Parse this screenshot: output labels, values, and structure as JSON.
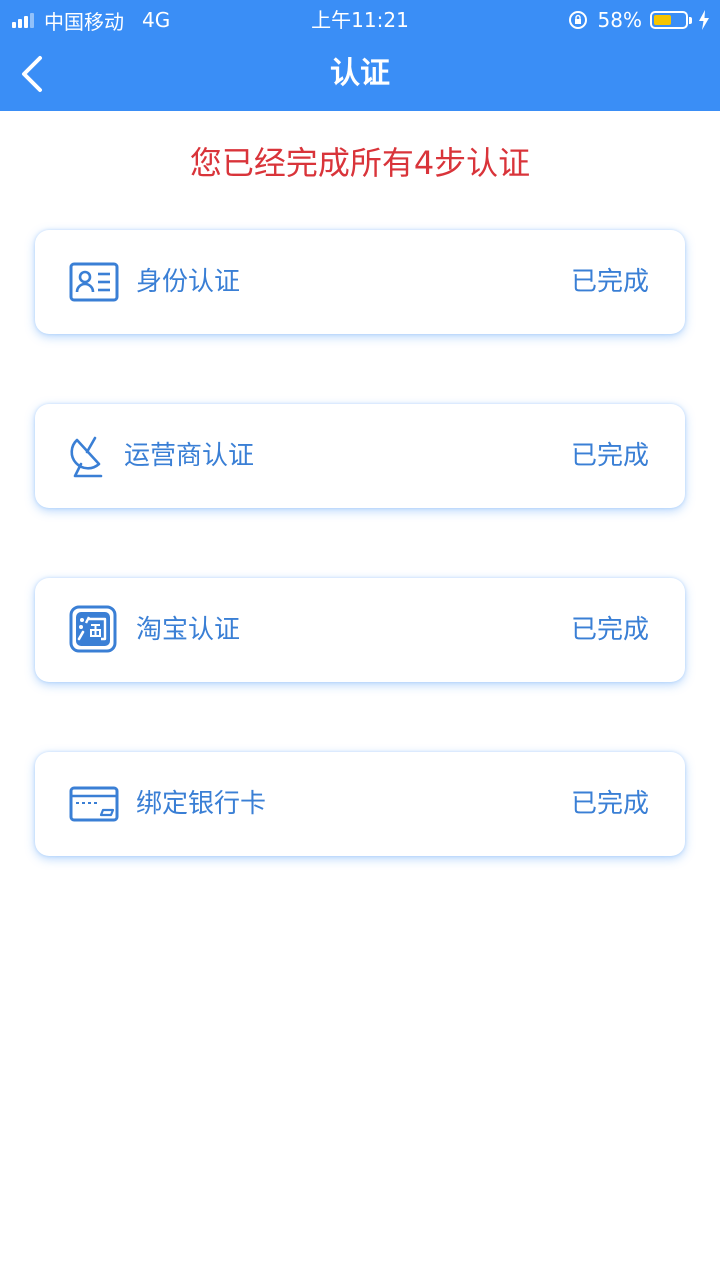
{
  "status_bar": {
    "carrier": "中国移动",
    "network": "4G",
    "time": "上午11:21",
    "battery_percent": "58%",
    "battery_level": 0.58
  },
  "header": {
    "title": "认证",
    "back_icon": "chevron-left-icon"
  },
  "headline": "您已经完成所有4步认证",
  "colors": {
    "header_bg": "#3a8ef6",
    "headline": "#d9343a",
    "accent": "#3a7fd5",
    "battery": "#f7c500"
  },
  "items": [
    {
      "label": "身份认证",
      "status": "已完成",
      "icon": "id-card-icon"
    },
    {
      "label": "运营商认证",
      "status": "已完成",
      "icon": "satellite-dish-icon"
    },
    {
      "label": "淘宝认证",
      "status": "已完成",
      "icon": "taobao-icon"
    },
    {
      "label": "绑定银行卡",
      "status": "已完成",
      "icon": "bank-card-icon"
    }
  ]
}
